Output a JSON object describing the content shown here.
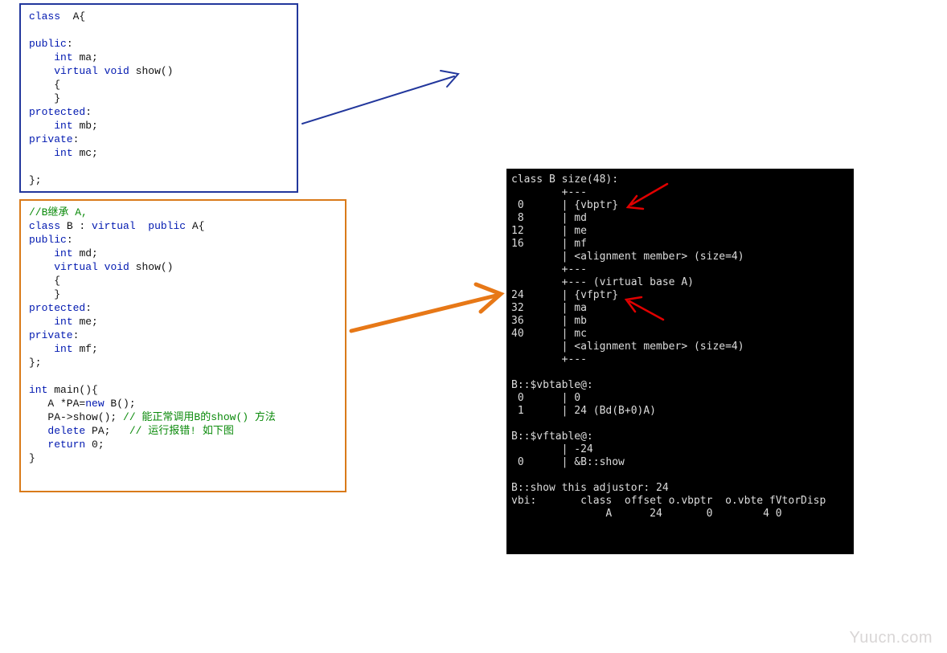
{
  "codeA": {
    "l1_kw": "class",
    "l1_sp": "  ",
    "l1_id": "A{",
    "l2": "",
    "l3_kw": "public",
    "l3_c": ":",
    "l4_pad": "    ",
    "l4_kw": "int",
    "l4_sp": " ",
    "l4_id": "ma;",
    "l5_pad": "    ",
    "l5_kw1": "virtual",
    "l5_sp1": " ",
    "l5_kw2": "void",
    "l5_sp2": " ",
    "l5_id": "show()",
    "l6_pad": "    ",
    "l6": "{",
    "l7_pad": "    ",
    "l7": "}",
    "l8_kw": "protected",
    "l8_c": ":",
    "l9_pad": "    ",
    "l9_kw": "int",
    "l9_sp": " ",
    "l9_id": "mb;",
    "l10_kw": "private",
    "l10_c": ":",
    "l11_pad": "    ",
    "l11_kw": "int",
    "l11_sp": " ",
    "l11_id": "mc;",
    "l12": "",
    "l13": "};"
  },
  "codeB": {
    "l1_cm": "//B继承 A,",
    "l2_kw1": "class",
    "l2_sp1": " ",
    "l2_id1": "B : ",
    "l2_kw2": "virtual",
    "l2_sp2": "  ",
    "l2_kw3": "public",
    "l2_sp3": " ",
    "l2_id2": "A{",
    "l3_kw": "public",
    "l3_c": ":",
    "l4_pad": "    ",
    "l4_kw": "int",
    "l4_sp": " ",
    "l4_id": "md;",
    "l5_pad": "    ",
    "l5_kw1": "virtual",
    "l5_sp1": " ",
    "l5_kw2": "void",
    "l5_sp2": " ",
    "l5_id": "show()",
    "l6_pad": "    ",
    "l6": "{",
    "l7_pad": "    ",
    "l7": "}",
    "l8_kw": "protected",
    "l8_c": ":",
    "l9_pad": "    ",
    "l9_kw": "int",
    "l9_sp": " ",
    "l9_id": "me;",
    "l10_kw": "private",
    "l10_c": ":",
    "l11_pad": "    ",
    "l11_kw": "int",
    "l11_sp": " ",
    "l11_id": "mf;",
    "l12": "};",
    "l13": "",
    "l14_kw": "int",
    "l14_sp": " ",
    "l14_id": "main(){",
    "l15_pad": "   ",
    "l15_id1": "A *PA=",
    "l15_kw": "new",
    "l15_id2": " B();",
    "l16_pad": "   ",
    "l16_id": "PA->show(); ",
    "l16_cm": "// 能正常调用B的show() 方法",
    "l17_pad": "   ",
    "l17_kw": "delete",
    "l17_id": " PA;   ",
    "l17_cm": "// 运行报错! 如下图",
    "l18_pad": "   ",
    "l18_kw": "return",
    "l18_id": " 0;",
    "l19": "}"
  },
  "terminal": {
    "l1": "class B size(48):",
    "l2": "        +---",
    "l3": " 0      | {vbptr}",
    "l4": " 8      | md",
    "l5": "12      | me",
    "l6": "16      | mf",
    "l7": "        | <alignment member> (size=4)",
    "l8": "        +---",
    "l9": "        +--- (virtual base A)",
    "l10": "24      | {vfptr}",
    "l11": "32      | ma",
    "l12": "36      | mb",
    "l13": "40      | mc",
    "l14": "        | <alignment member> (size=4)",
    "l15": "        +---",
    "l16": "",
    "l17": "B::$vbtable@:",
    "l18": " 0      | 0",
    "l19": " 1      | 24 (Bd(B+0)A)",
    "l20": "",
    "l21": "B::$vftable@:",
    "l22": "        | -24",
    "l23": " 0      | &B::show",
    "l24": "",
    "l25": "B::show this adjustor: 24",
    "l26": "vbi:       class  offset o.vbptr  o.vbte fVtorDisp",
    "l27": "               A      24       0        4 0"
  },
  "watermark": "Yuucn.com"
}
